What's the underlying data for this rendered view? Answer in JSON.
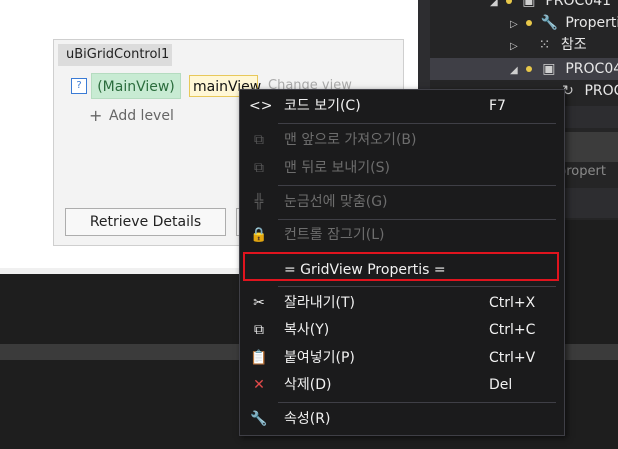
{
  "designer": {
    "grid_title": "uBiGridControl1",
    "help_glyph": "?",
    "mainview_chip": "(MainView)",
    "mainview_link": "mainView",
    "change_view": "Change view",
    "add_level_plus": "+",
    "add_level": "Add level",
    "retrieve_details": "Retrieve Details"
  },
  "solution_explorer": {
    "rows": [
      {
        "label": "PROC041",
        "expand": "◢",
        "icon": "cube-icon"
      },
      {
        "label": "Properties",
        "expand": "▷",
        "icon": "wrench-icon"
      },
      {
        "label": "참조",
        "expand": "▷",
        "icon": "references-icon"
      },
      {
        "label": "PROC04",
        "expand": "◢",
        "icon": "cube-icon",
        "selected": true
      },
      {
        "label": "PROC",
        "expand": "",
        "icon": "file-icon"
      }
    ],
    "properties_partial": "propert"
  },
  "context_menu": {
    "items": [
      {
        "label": "코드 보기(C)",
        "shortcut": "F7",
        "icon": "code-icon",
        "glyph": "<>",
        "disabled": false
      },
      {
        "label": "맨 앞으로 가져오기(B)",
        "shortcut": "",
        "icon": "bring-to-front-icon",
        "glyph": "⧉",
        "disabled": true
      },
      {
        "label": "맨 뒤로 보내기(S)",
        "shortcut": "",
        "icon": "send-to-back-icon",
        "glyph": "⧉",
        "disabled": true
      },
      {
        "label": "눈금선에 맞춤(G)",
        "shortcut": "",
        "icon": "align-to-grid-icon",
        "glyph": "╬",
        "disabled": true
      },
      {
        "label": "컨트롤 잠그기(L)",
        "shortcut": "",
        "icon": "lock-icon",
        "glyph": "🔒",
        "disabled": true
      },
      {
        "label": "= GridView Propertis =",
        "shortcut": "",
        "icon": "",
        "glyph": "",
        "disabled": false
      },
      {
        "label": "잘라내기(T)",
        "shortcut": "Ctrl+X",
        "icon": "cut-icon",
        "glyph": "✂",
        "disabled": false
      },
      {
        "label": "복사(Y)",
        "shortcut": "Ctrl+C",
        "icon": "copy-icon",
        "glyph": "⧉",
        "disabled": false
      },
      {
        "label": "붙여넣기(P)",
        "shortcut": "Ctrl+V",
        "icon": "paste-icon",
        "glyph": "📋",
        "disabled": false
      },
      {
        "label": "삭제(D)",
        "shortcut": "Del",
        "icon": "delete-icon",
        "glyph": "✕",
        "disabled": false
      },
      {
        "label": "속성(R)",
        "shortcut": "",
        "icon": "properties-wrench-icon",
        "glyph": "🔧",
        "disabled": false
      }
    ]
  },
  "colors": {
    "menu_bg": "#1b1b1c",
    "highlight_border": "#e0141e",
    "delete_icon": "#e24a4a",
    "chip_green": "#c8ebd3"
  }
}
